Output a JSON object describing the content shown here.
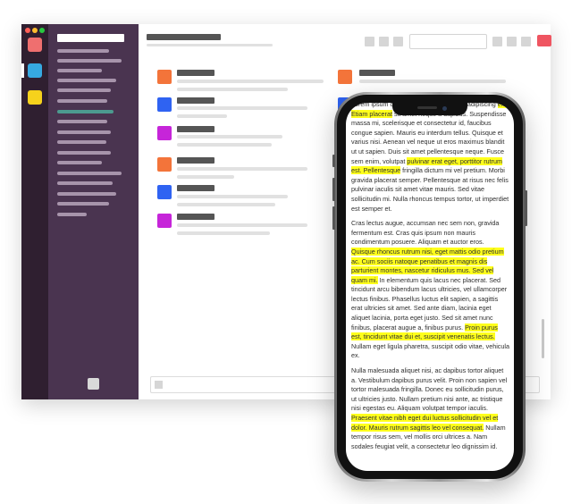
{
  "accent_colors": {
    "workspace_1": "#ef6f6f",
    "workspace_2": "#36a9e1",
    "workspace_3": "#f6d21c",
    "avatar_orange": "#f3743a",
    "avatar_blue": "#2f63f2",
    "avatar_magenta": "#c625d9",
    "highlight": "#ffff1c",
    "action_red": "#ef5561"
  },
  "phone": {
    "paragraphs": [
      [
        {
          "t": "Lorem ipsum dolor sit amet, consectetur adipiscing ",
          "h": false
        },
        {
          "t": "elit. Etiam placerat",
          "h": true
        },
        {
          "t": " sit amet neque a dapibus. Suspendisse massa mi, scelerisque et consectetur id, faucibus congue sapien. Mauris eu interdum tellus. Quisque et varius nisi. Aenean vel neque ut eros maximus blandit ut ut sapien. Duis sit amet pellentesque neque. Fusce sem enim, volutpat ",
          "h": false
        },
        {
          "t": "pulvinar erat eget, porttitor rutrum est. Pellentesque",
          "h": true
        },
        {
          "t": " fringilla dictum mi vel pretium. Morbi gravida placerat semper. Pellentesque at risus nec felis pulvinar iaculis sit amet vitae mauris. Sed vitae sollicitudin mi. Nulla rhoncus tempus tortor, ut imperdiet est semper et.",
          "h": false
        }
      ],
      [
        {
          "t": "Cras lectus augue, accumsan nec sem non, gravida fermentum est. Cras quis ipsum non mauris condimentum posuere. Aliquam et auctor eros. ",
          "h": false
        },
        {
          "t": "Quisque rhoncus rutrum nisi, eget mattis odio pretium ac. Cum sociis natoque penatibus et magnis dis parturient montes, nascetur ridiculus mus. Sed vel quam mi.",
          "h": true
        },
        {
          "t": " In elementum quis lacus nec placerat. Sed tincidunt arcu bibendum lacus ultricies, vel ullamcorper lectus finibus. Phasellus luctus elit sapien, a sagittis erat ultricies sit amet. Sed ante diam, lacinia eget aliquet lacinia, porta eget justo. Sed sit amet nunc finibus, placerat augue a, finibus purus. ",
          "h": false
        },
        {
          "t": "Proin purus est, tincidunt vitae dui et, suscipit venenatis lectus.",
          "h": true
        },
        {
          "t": " Nullam eget ligula pharetra, suscipit odio vitae, vehicula ex.",
          "h": false
        }
      ],
      [
        {
          "t": "Nulla malesuada aliquet nisi, ac dapibus tortor aliquet a. Vestibulum dapibus purus velit. Proin non sapien vel tortor malesuada fringilla. Donec eu sollicitudin purus, ut ultricies justo. Nullam pretium nisi ante, ac tristique nisi egestas eu. Aliquam volutpat tempor iaculis. ",
          "h": false
        },
        {
          "t": "Praesent vitae nibh eget dui luctus sollicitudin vel et dolor. Mauris rutrum sagittis leo vel consequat.",
          "h": true
        },
        {
          "t": " Nullam tempor risus sem, vel mollis orci ultrices a. Nam sodales feugiat velit, a consectetur leo dignissim id.",
          "h": false
        }
      ]
    ]
  }
}
